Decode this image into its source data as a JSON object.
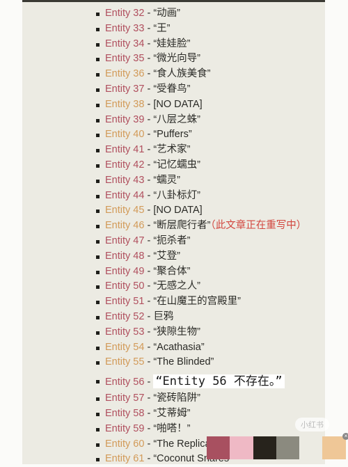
{
  "entities": [
    {
      "label": "Entity 32",
      "sep": " - ",
      "name": "“动画”",
      "color": "red"
    },
    {
      "label": "Entity 33",
      "sep": " - ",
      "name": "“王”",
      "color": "red"
    },
    {
      "label": "Entity 34",
      "sep": " - ",
      "name": "“娃娃脸”",
      "color": "red"
    },
    {
      "label": "Entity 35",
      "sep": " - ",
      "name": "“微光向导”",
      "color": "red"
    },
    {
      "label": "Entity 36",
      "sep": " - ",
      "name": "“食人族美食”",
      "color": "orange"
    },
    {
      "label": "Entity 37",
      "sep": " - ",
      "name": "“受眷鸟”",
      "color": "red"
    },
    {
      "label": "Entity 38",
      "sep": " - ",
      "name": "[NO DATA]",
      "color": "orange"
    },
    {
      "label": "Entity 39",
      "sep": " - ",
      "name": "“八层之蛛”",
      "color": "red"
    },
    {
      "label": "Entity 40",
      "sep": " - ",
      "name": "“Puffers”",
      "color": "orange"
    },
    {
      "label": "Entity 41",
      "sep": " - ",
      "name": "“艺术家”",
      "color": "red"
    },
    {
      "label": "Entity 42",
      "sep": " - ",
      "name": "“记忆蠕虫”",
      "color": "red"
    },
    {
      "label": "Entity 43",
      "sep": " - ",
      "name": "“蠕灵”",
      "color": "red"
    },
    {
      "label": "Entity 44",
      "sep": " - ",
      "name": "“八卦标灯”",
      "color": "red"
    },
    {
      "label": "Entity 45",
      "sep": " - ",
      "name": "[NO DATA]",
      "color": "orange"
    },
    {
      "label": "Entity 46",
      "sep": " - ",
      "name": "“断层爬行者”",
      "color": "orange",
      "note": "（此文章正在重写中）"
    },
    {
      "label": "Entity 47",
      "sep": " - ",
      "name": "“扼杀者”",
      "color": "red"
    },
    {
      "label": "Entity 48",
      "sep": " - ",
      "name": "“艾登”",
      "color": "red"
    },
    {
      "label": "Entity 49",
      "sep": " - ",
      "name": "“聚合体”",
      "color": "red"
    },
    {
      "label": "Entity 50",
      "sep": " - ",
      "name": "“无感之人”",
      "color": "red"
    },
    {
      "label": "Entity 51",
      "sep": " - ",
      "name": "“在山魔王的宫殿里”",
      "color": "red"
    },
    {
      "label": "Entity 52",
      "sep": " - ",
      "name": "巨鸦",
      "color": "red"
    },
    {
      "label": "Entity 53",
      "sep": " - ",
      "name": "“狭隙生物”",
      "color": "red"
    },
    {
      "label": "Entity 54",
      "sep": " - ",
      "name": "“Acathasia”",
      "color": "orange"
    },
    {
      "label": "Entity 55",
      "sep": " - ",
      "name": "“The Blinded”",
      "color": "orange"
    },
    {
      "label": "Entity 56",
      "sep": " - ",
      "name": "“Entity 56 不存在。”",
      "color": "red",
      "big": true
    },
    {
      "label": "Entity 57",
      "sep": " - ",
      "name": "“瓷砖陷阱”",
      "color": "red"
    },
    {
      "label": "Entity 58",
      "sep": " - ",
      "name": "“艾蒂姆”",
      "color": "red"
    },
    {
      "label": "Entity 59",
      "sep": " - ",
      "name": "“啪嗒！”",
      "color": "red"
    },
    {
      "label": "Entity 60",
      "sep": " - ",
      "name": "“The Replicants”",
      "color": "orange"
    },
    {
      "label": "Entity 61",
      "sep": " - ",
      "name": "“Coconut Snares”",
      "color": "orange"
    }
  ],
  "palette": [
    "#a85060",
    "#efb9c5",
    "#27231c",
    "#8b8a7f",
    "#ecebe3",
    "#efc797"
  ],
  "watermark": "小红书"
}
